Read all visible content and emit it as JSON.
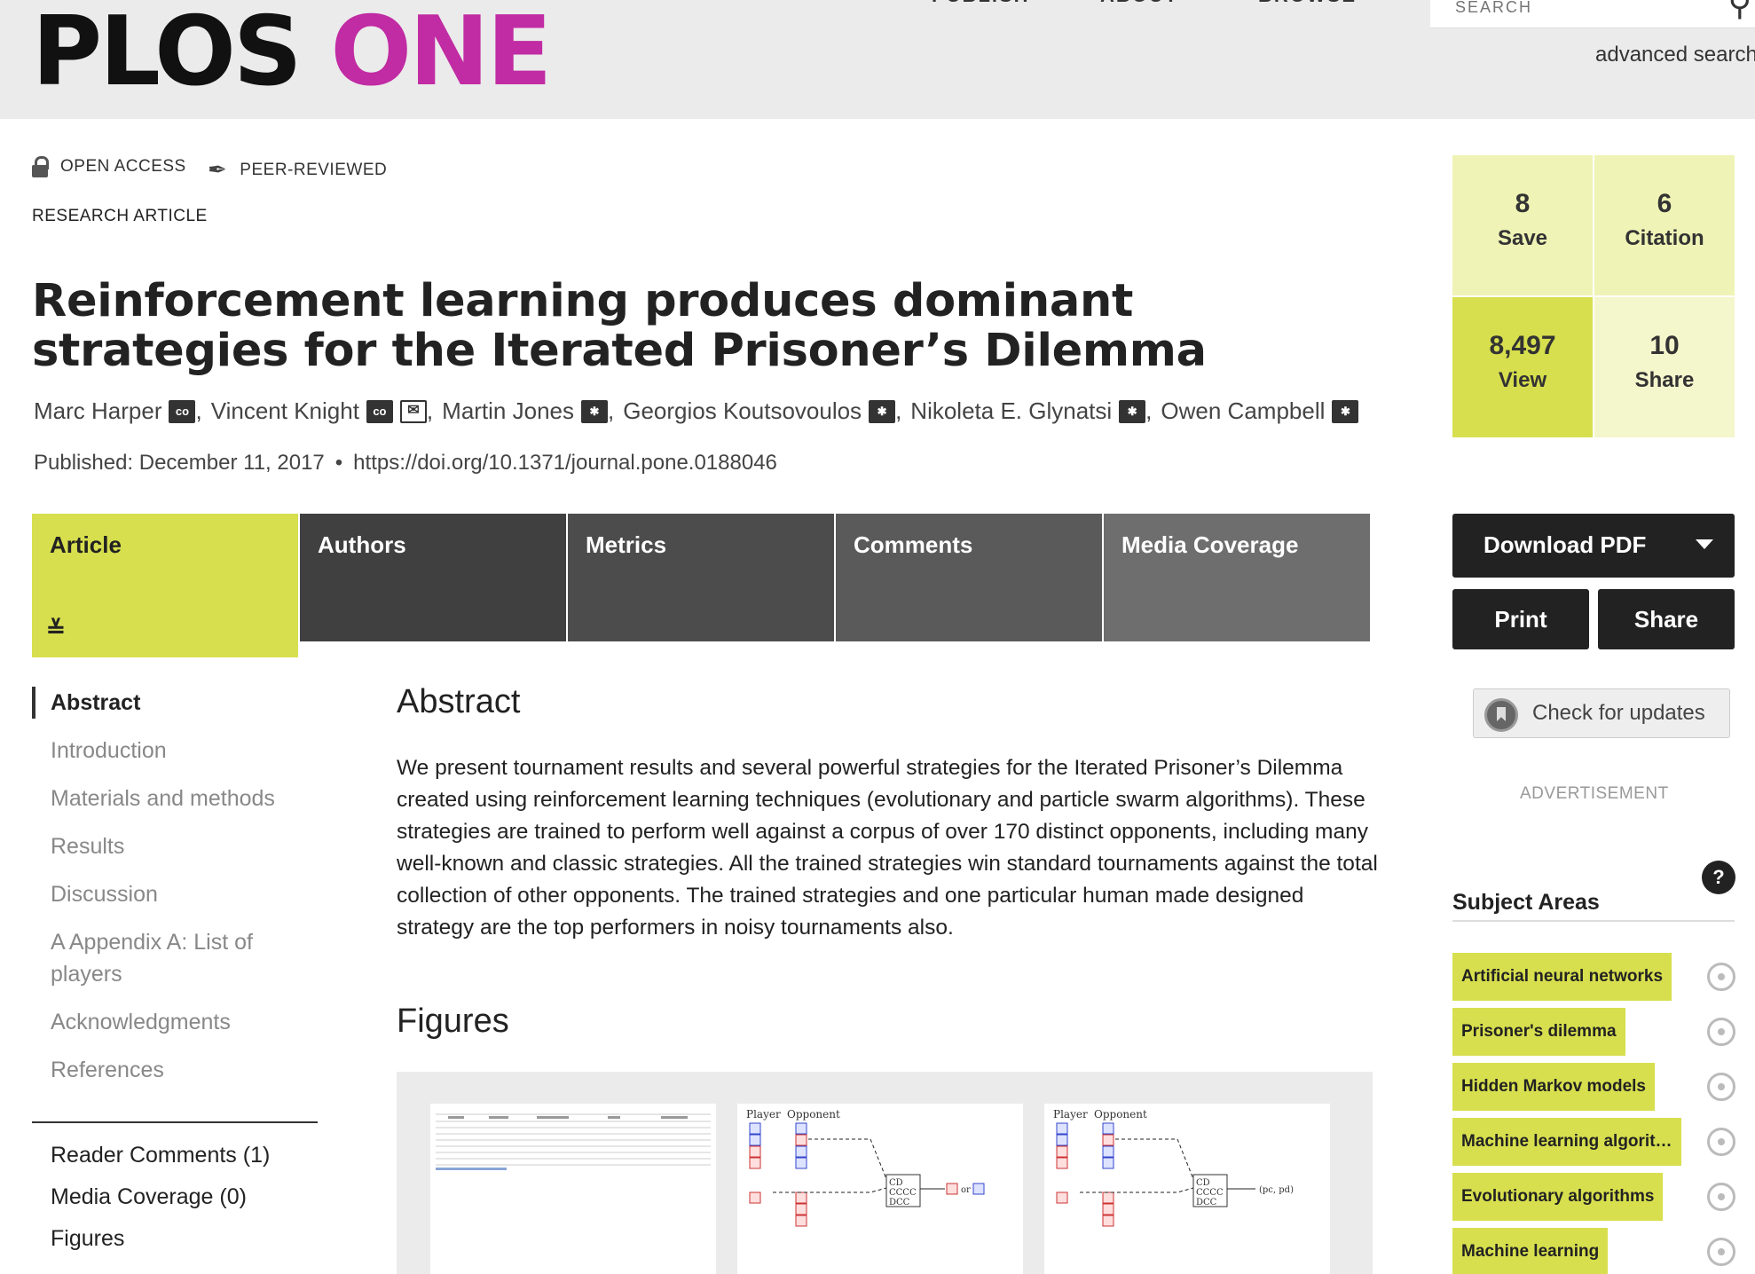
{
  "header": {
    "logo_part1": "PLOS",
    "logo_part2": "ONE",
    "nav": [
      "PUBLISH",
      "ABOUT",
      "BROWSE"
    ],
    "search_placeholder": "SEARCH",
    "advanced_search": "advanced search"
  },
  "badges": {
    "open_access": "OPEN ACCESS",
    "peer_reviewed": "PEER-REVIEWED"
  },
  "article_type": "RESEARCH ARTICLE",
  "title": "Reinforcement learning produces dominant strategies for the Iterated Prisoner’s Dilemma",
  "authors": [
    {
      "name": "Marc Harper",
      "icons": [
        "co"
      ]
    },
    {
      "name": "Vincent Knight",
      "icons": [
        "co",
        "mail"
      ]
    },
    {
      "name": "Martin Jones",
      "icons": [
        "star"
      ]
    },
    {
      "name": "Georgios Koutsovoulos",
      "icons": [
        "star"
      ]
    },
    {
      "name": "Nikoleta E. Glynatsi",
      "icons": [
        "star"
      ]
    },
    {
      "name": "Owen Campbell",
      "icons": [
        "star"
      ]
    }
  ],
  "published": "Published: December 11, 2017",
  "doi": "https://doi.org/10.1371/journal.pone.0188046",
  "tabs": [
    "Article",
    "Authors",
    "Metrics",
    "Comments",
    "Media Coverage"
  ],
  "leftnav": {
    "items": [
      "Abstract",
      "Introduction",
      "Materials and methods",
      "Results",
      "Discussion",
      "A Appendix A: List of players",
      "Acknowledgments",
      "References"
    ],
    "extras": [
      "Reader Comments (1)",
      "Media Coverage (0)",
      "Figures"
    ]
  },
  "main": {
    "abstract_heading": "Abstract",
    "abstract_text": "We present tournament results and several powerful strategies for the Iterated Prisoner’s Dilemma created using reinforcement learning techniques (evolutionary and particle swarm algorithms). These strategies are trained to perform well against a corpus of over 170 distinct opponents, including many well-known and classic strategies. All the trained strategies win standard tournaments against the total collection of other opponents. The trained strategies and one particular human made designed strategy are the top performers in noisy tournaments also.",
    "figures_heading": "Figures",
    "figure_labels": {
      "player": "Player",
      "opponent": "Opponent",
      "or": "or",
      "pcpd": "(pc, pd)"
    }
  },
  "metrics": [
    {
      "value": "8",
      "label": "Save"
    },
    {
      "value": "6",
      "label": "Citation"
    },
    {
      "value": "8,497",
      "label": "View"
    },
    {
      "value": "10",
      "label": "Share"
    }
  ],
  "actions": {
    "download_pdf": "Download PDF",
    "print": "Print",
    "share": "Share",
    "check_updates": "Check for updates"
  },
  "advertisement": "ADVERTISEMENT",
  "subject_areas": {
    "title": "Subject Areas",
    "help": "?",
    "items": [
      "Artificial neural networks",
      "Prisoner's dilemma",
      "Hidden Markov models",
      "Machine learning algorit…",
      "Evolutionary algorithms",
      "Machine learning"
    ]
  },
  "colors": {
    "brand_magenta": "#c12ba3",
    "accent_lime": "#d7df4e",
    "metric_light": "#eff3b5",
    "tab_dark": "#404040"
  }
}
